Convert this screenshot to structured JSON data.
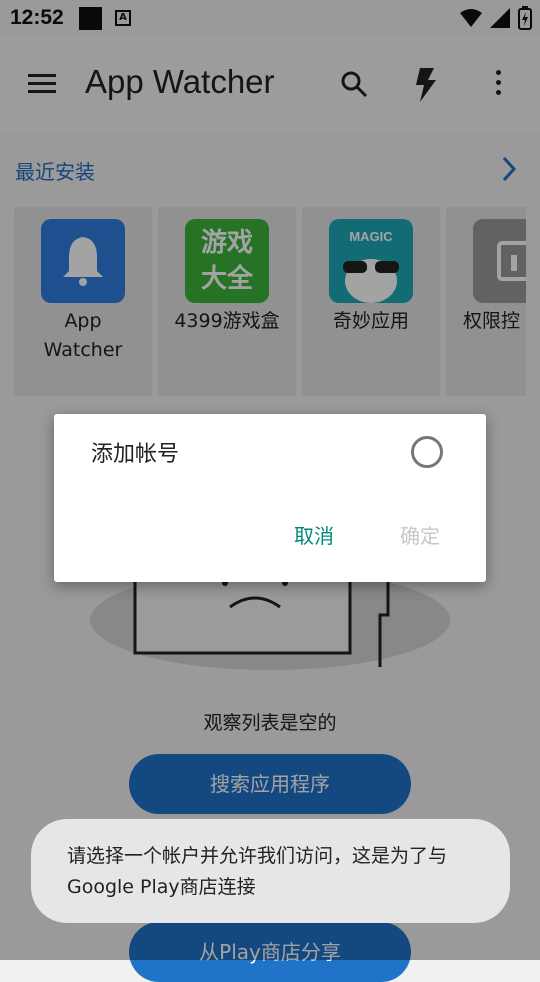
{
  "status_bar": {
    "time": "12:52"
  },
  "app_bar": {
    "title": "App Watcher"
  },
  "recent": {
    "title": "最近安装",
    "apps": [
      {
        "label": "App\nWatcher",
        "color": "#2f7de0"
      },
      {
        "label": "4399游戏盒",
        "color": "#3cb43c"
      },
      {
        "label": "奇妙应用",
        "color": "#1faab8"
      },
      {
        "label": "权限控",
        "color": "#9a9a9a"
      }
    ]
  },
  "empty_state": {
    "text": "观察列表是空的",
    "buttons": [
      "搜索应用程序",
      "",
      "从Play商店分享"
    ]
  },
  "dialog": {
    "option_label": "添加帐号",
    "cancel_label": "取消",
    "ok_label": "确定"
  },
  "toast": {
    "text": "请选择一个帐户并允许我们访问，这是为了与Google Play商店连接"
  },
  "colors": {
    "accent": "#1f6fc4",
    "dialog_action": "#00897b"
  }
}
